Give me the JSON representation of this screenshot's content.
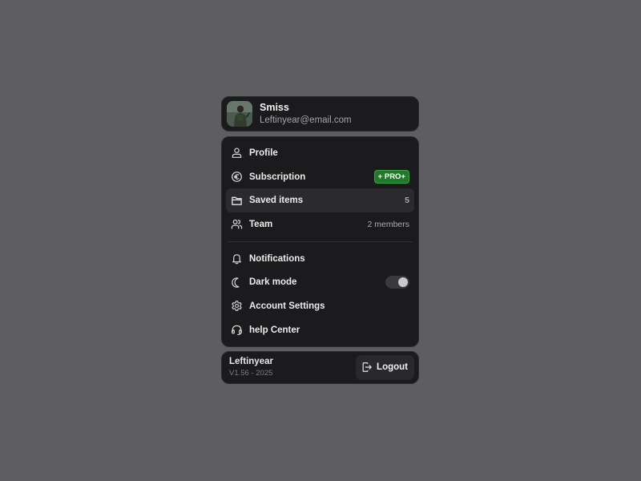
{
  "user": {
    "name": "Smiss",
    "email": "Leftinyear@email.com"
  },
  "menu": {
    "items": [
      {
        "label": "Profile",
        "icon": "user-icon"
      },
      {
        "label": "Subscription",
        "icon": "euro-icon",
        "badge": "+ PRO+"
      },
      {
        "label": "Saved items",
        "icon": "folder-icon",
        "count": "5"
      },
      {
        "label": "Team",
        "icon": "users-icon",
        "meta": "2 members"
      },
      {
        "label": "Notifications",
        "icon": "bell-icon"
      },
      {
        "label": "Dark mode",
        "icon": "moon-icon",
        "toggle_on": true
      },
      {
        "label": "Account Settings",
        "icon": "gear-icon"
      },
      {
        "label": "help Center",
        "icon": "headset-icon"
      }
    ]
  },
  "footer": {
    "app_name": "Leftinyear",
    "version": "V1.56 - 2025",
    "logout_label": "Logout"
  },
  "colors": {
    "background": "#5e5d60",
    "card": "#1b1a1d",
    "active_item": "#2b2a2e",
    "pro_badge": "#1f7a2a"
  }
}
